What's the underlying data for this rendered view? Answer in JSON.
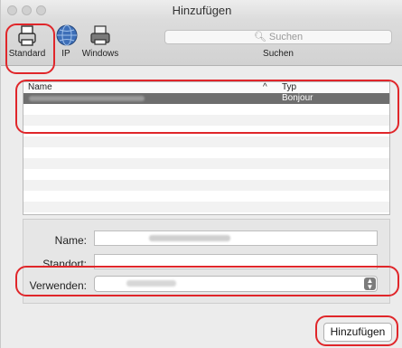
{
  "window": {
    "title": "Hinzufügen"
  },
  "toolbar": {
    "buttons": [
      {
        "label": "Standard",
        "icon": "default-printer-icon",
        "selected": true
      },
      {
        "label": "IP",
        "icon": "globe-icon"
      },
      {
        "label": "Windows",
        "icon": "windows-printer-icon"
      }
    ],
    "search": {
      "placeholder": "Suchen",
      "caption": "Suchen"
    }
  },
  "printer_list": {
    "columns": [
      "Name",
      "Typ"
    ],
    "sort_indicator": "^",
    "rows": [
      {
        "name": "",
        "type": "Bonjour",
        "selected": true
      }
    ]
  },
  "form": {
    "name_label": "Name:",
    "location_label": "Standort:",
    "driver_label": "Verwenden:",
    "location_value": ""
  },
  "actions": {
    "add_label": "Hinzufügen"
  },
  "colors": {
    "annotation": "#e0262a",
    "selection": "#6e6e6e"
  }
}
